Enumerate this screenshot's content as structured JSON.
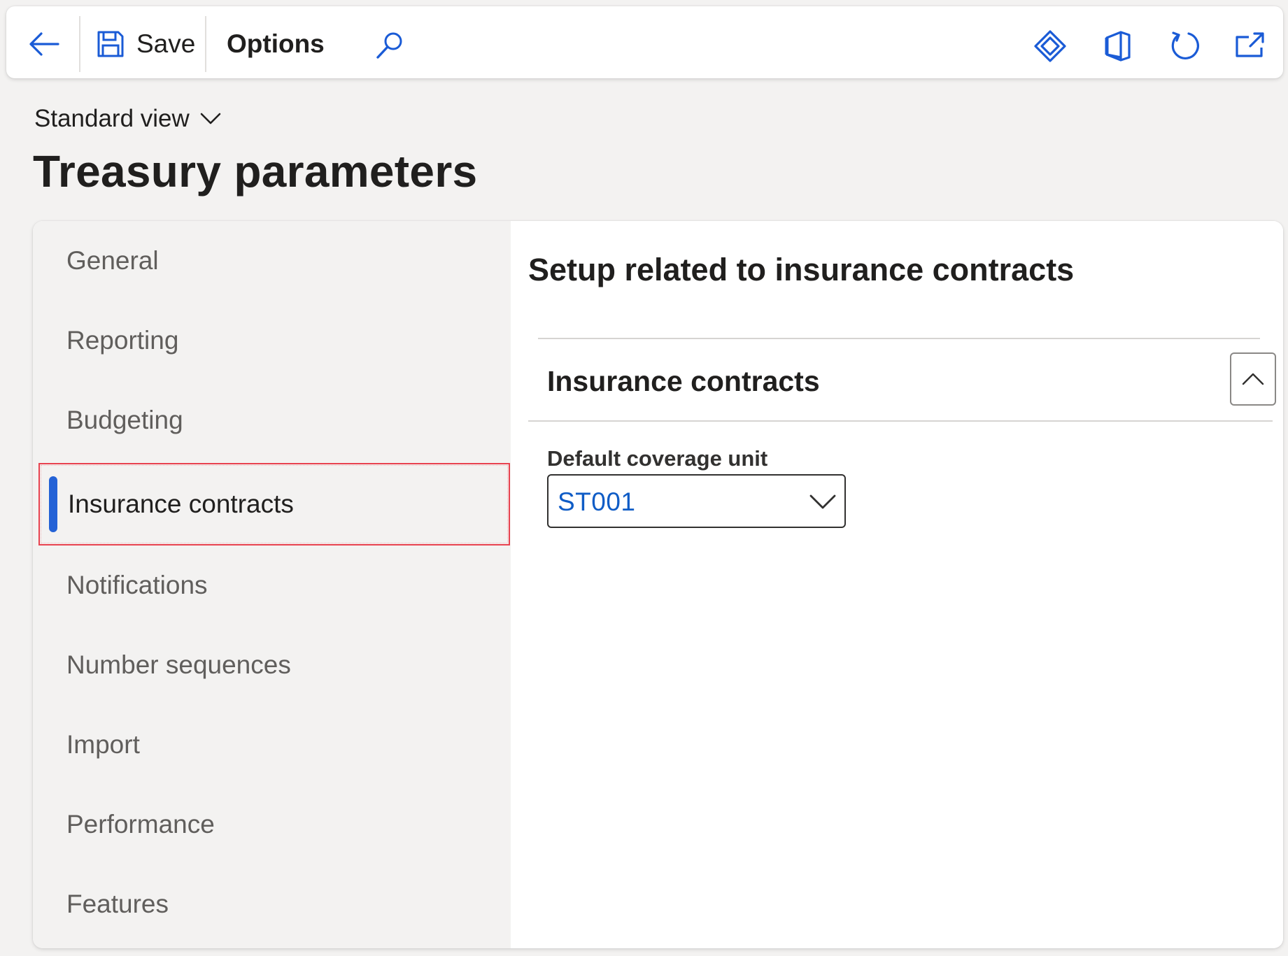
{
  "toolbar": {
    "back_icon": "back-arrow-icon",
    "save_label": "Save",
    "options_label": "Options",
    "search_icon": "search-icon",
    "right_icons": [
      "power-apps-icon",
      "office-icon",
      "refresh-icon",
      "open-in-new-window-icon"
    ]
  },
  "header": {
    "view_label": "Standard view",
    "title": "Treasury parameters"
  },
  "nav": {
    "items": [
      {
        "label": "General"
      },
      {
        "label": "Reporting"
      },
      {
        "label": "Budgeting"
      },
      {
        "label": "Insurance contracts",
        "active": true
      },
      {
        "label": "Notifications"
      },
      {
        "label": "Number sequences"
      },
      {
        "label": "Import"
      },
      {
        "label": "Performance"
      },
      {
        "label": "Features"
      }
    ]
  },
  "content": {
    "title": "Setup related to insurance contracts",
    "section_title": "Insurance contracts",
    "field_label": "Default coverage unit",
    "field_value": "ST001"
  },
  "colors": {
    "accent": "#2462d6",
    "icon_blue": "#1a5bd6",
    "highlight_outline": "#e8424f",
    "link_value": "#0f5cc6"
  }
}
